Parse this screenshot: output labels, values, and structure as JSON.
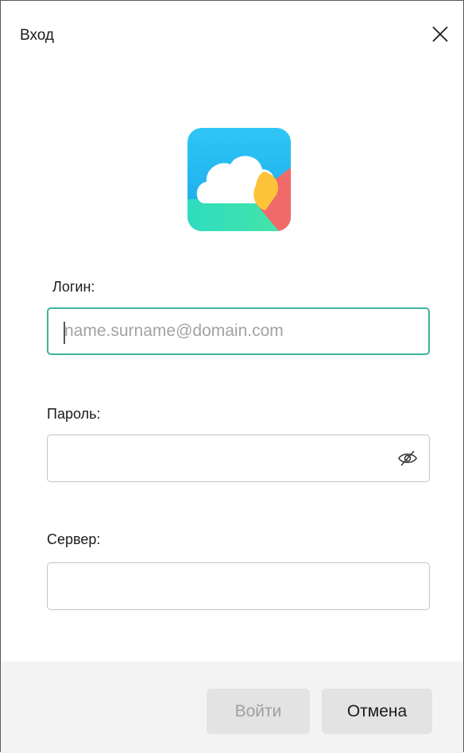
{
  "window": {
    "title": "Вход"
  },
  "icons": {
    "close": "close-icon",
    "logo": "cloud-logo-icon",
    "password_visibility": "eye-slash-icon"
  },
  "form": {
    "login": {
      "label": "Логин:",
      "value": "",
      "placeholder": "name.surname@domain.com"
    },
    "password": {
      "label": "Пароль:",
      "value": "",
      "placeholder": ""
    },
    "server": {
      "label": "Сервер:",
      "value": "",
      "placeholder": ""
    }
  },
  "footer": {
    "login_button": "Войти",
    "cancel_button": "Отмена"
  },
  "colors": {
    "focus_border": "#3cb39a",
    "disabled_text": "#a0a0a0",
    "footer_bg": "#f3f3f3",
    "button_bg": "#e3e3e3"
  }
}
